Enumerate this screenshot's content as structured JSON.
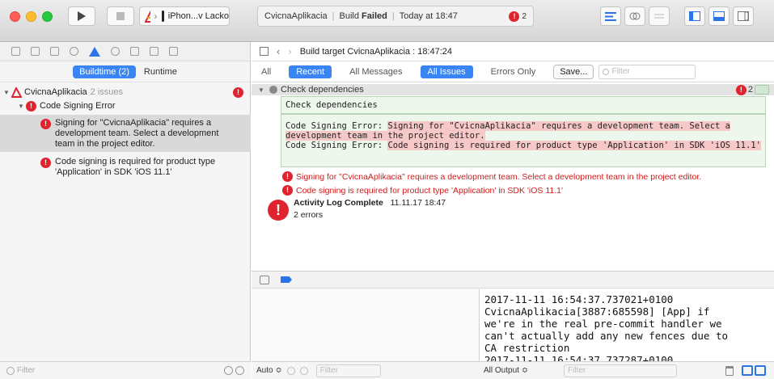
{
  "toolbar": {
    "scheme_label": "iPhon...v Lacko",
    "activity": {
      "project": "CvicnaAplikacia",
      "build_label": "Build",
      "build_status": "Failed",
      "time": "Today at 18:47",
      "error_count": "2"
    }
  },
  "navigator": {
    "segments": [
      "Buildtime (2)",
      "Runtime"
    ],
    "project_name": "CvicnaAplikacia",
    "project_issues": "2 issues",
    "group_label": "Code Signing Error",
    "issues": [
      "Signing for \"CvicnaAplikacia\" requires a development team. Select a development team in the project editor.",
      "Code signing is required for product type 'Application' in SDK 'iOS 11.1'"
    ],
    "filter_placeholder": "Filter"
  },
  "editor": {
    "jump_title": "Build target CvicnaAplikacia : 18:47:24",
    "filters": [
      "All",
      "Recent",
      "All Messages",
      "All Issues",
      "Errors Only"
    ],
    "save_label": "Save...",
    "filter_placeholder": "Filter",
    "section_title": "Check dependencies",
    "section_error_count": "2",
    "check_text": "Check dependencies",
    "error_lines": [
      {
        "prefix": "Code Signing Error: ",
        "text": "Signing for \"CvicnaAplikacia\" requires a development team. Select a development team in the project editor."
      },
      {
        "prefix": "Code Signing Error: ",
        "text": "Code signing is required for product type 'Application' in SDK 'iOS 11.1'"
      }
    ],
    "issue_lines": [
      "Signing for \"CvicnaAplikacia\" requires a development team. Select a development team in the project editor.",
      "Code signing is required for product type 'Application' in SDK 'iOS 11.1'"
    ],
    "complete_title": "Activity Log Complete",
    "complete_time": "11.11.17 18:47",
    "complete_errors": "2 errors"
  },
  "debug": {
    "console_text": "2017-11-11 16:54:37.737021+0100\nCvicnaAplikacia[3887:685598] [App] if\nwe're in the real pre-commit handler we\ncan't actually add any new fences due to\nCA restriction\n2017-11-11 16:54:37.737287+0100",
    "auto_label": "Auto ≎",
    "vars_filter": "Filter",
    "output_label": "All Output ≎",
    "console_filter": "Filter"
  },
  "colors": {
    "accent": "#3a85f4",
    "error": "#e0242d",
    "error_text": "#d11b1b"
  }
}
